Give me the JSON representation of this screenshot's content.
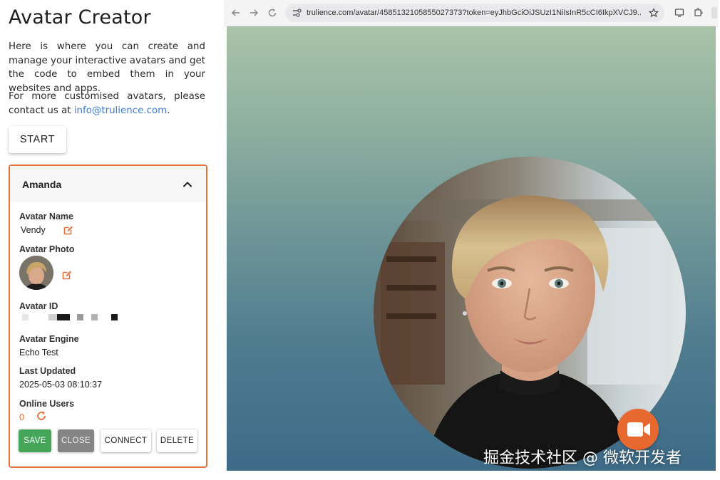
{
  "page": {
    "title": "Avatar Creator",
    "description": "Here is where you can create and manage your interactive avatars and get the code to embed them in your websites and apps.",
    "contact_prefix": "For more customised avatars, please contact us at ",
    "contact_email": "info@trulience.com",
    "contact_suffix": ".",
    "start_label": "START"
  },
  "card": {
    "header_name": "Amanda",
    "avatar_name_label": "Avatar Name",
    "avatar_name_value": "Vendy",
    "avatar_photo_label": "Avatar Photo",
    "avatar_id_label": "Avatar ID",
    "avatar_engine_label": "Avatar Engine",
    "avatar_engine_value": "Echo Test",
    "last_updated_label": "Last Updated",
    "last_updated_value": "2025-05-03 08:10:37",
    "online_users_label": "Online Users",
    "online_users_value": "0",
    "buttons": {
      "save": "SAVE",
      "close": "CLOSE",
      "connect": "CONNECT",
      "delete": "DELETE"
    }
  },
  "browser": {
    "url": "trulience.com/avatar/4585132105855027373?token=eyJhbGciOiJSUzI1NiIsInR5cCI6IkpXVCJ9..."
  },
  "watermark": "掘金技术社区 @ 微软开发者",
  "colors": {
    "accent": "#e8703a",
    "save_green": "#45a65a",
    "close_gray": "#858585",
    "link_blue": "#3b7bd5"
  },
  "icons": [
    "chevron-up-icon",
    "edit-icon",
    "refresh-icon",
    "back-icon",
    "forward-icon",
    "reload-icon",
    "site-settings-icon",
    "star-icon",
    "video-camera-icon"
  ]
}
